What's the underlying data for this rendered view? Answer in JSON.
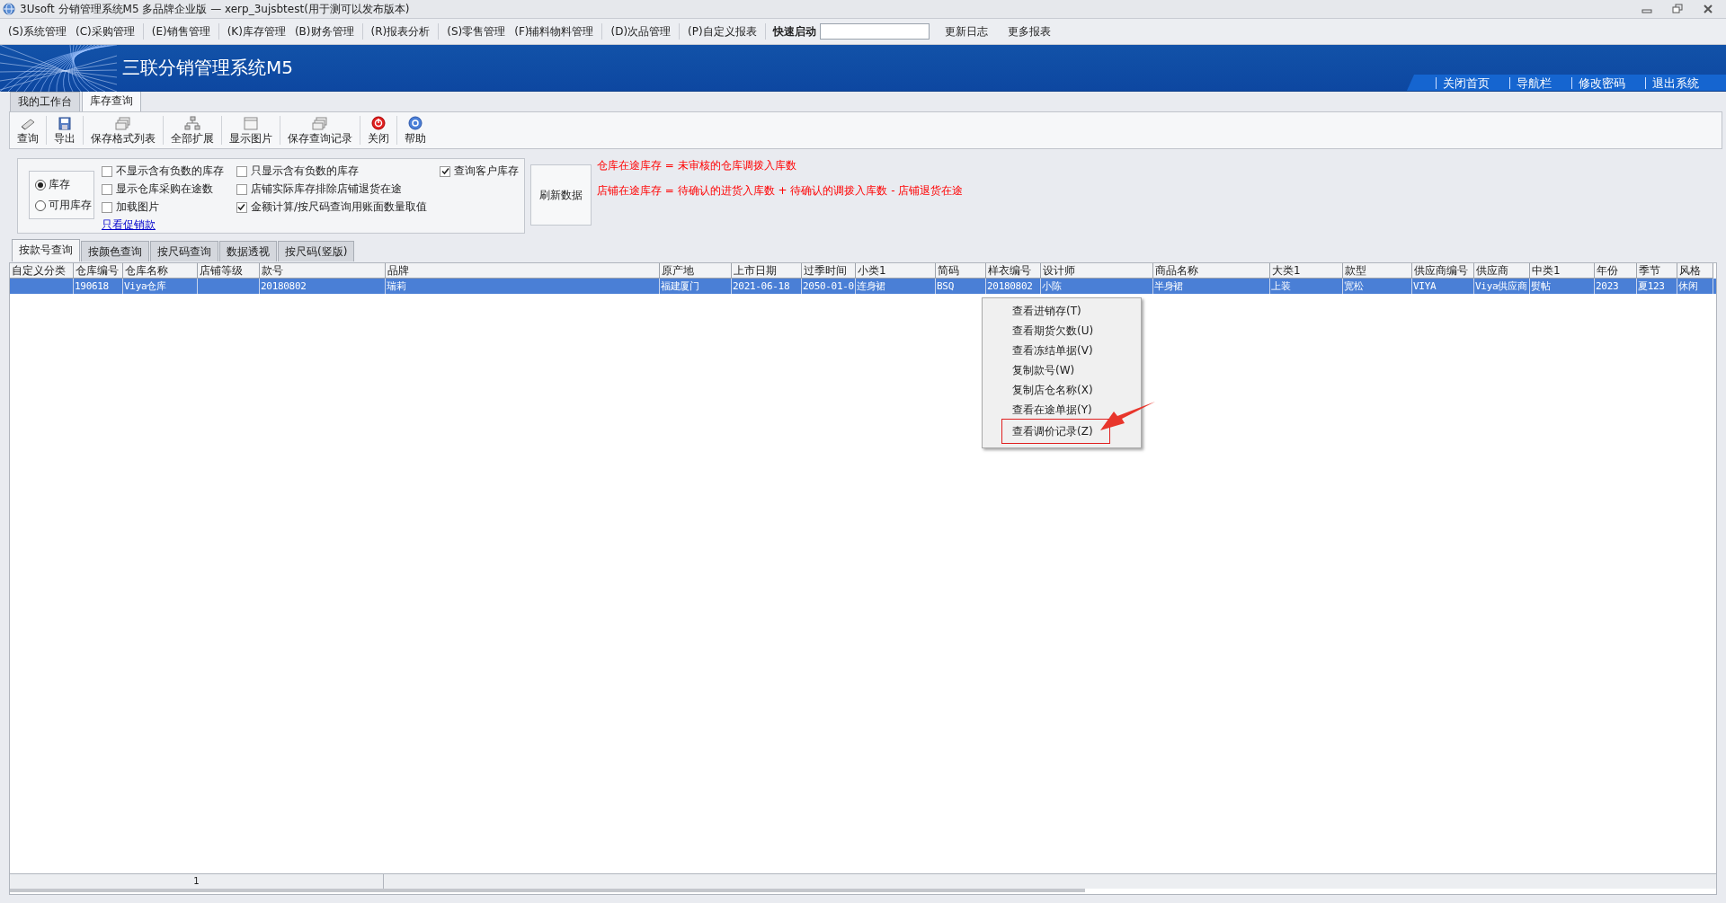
{
  "window": {
    "title": "3Usoft 分销管理系统M5 多品牌企业版 — xerp_3ujsbtest(用于测可以发布版本)"
  },
  "menu_bar": {
    "items": [
      {
        "label": "(S)系统管理",
        "group_end": false
      },
      {
        "label": "(C)采购管理",
        "group_end": true
      },
      {
        "label": "(E)销售管理",
        "group_end": true
      },
      {
        "label": "(K)库存管理",
        "group_end": false
      },
      {
        "label": "(B)财务管理",
        "group_end": true
      },
      {
        "label": "(R)报表分析",
        "group_end": true
      },
      {
        "label": "(S)零售管理",
        "group_end": false
      },
      {
        "label": "(F)辅料物料管理",
        "group_end": true
      },
      {
        "label": "(D)次品管理",
        "group_end": true
      },
      {
        "label": "(P)自定义报表",
        "group_end": true
      }
    ],
    "quick_launch_label": "快速启动",
    "links": [
      "更新日志",
      "更多报表"
    ]
  },
  "banner": {
    "title": "三联分销管理系统M5",
    "links": [
      "关闭首页",
      "导航栏",
      "修改密码",
      "退出系统"
    ]
  },
  "page_tabs": [
    {
      "label": "我的工作台",
      "selected": false
    },
    {
      "label": "库存查询",
      "selected": true
    }
  ],
  "toolbar": [
    "查询",
    "导出",
    "保存格式列表",
    "全部扩展",
    "显示图片",
    "保存查询记录",
    "关闭",
    "帮助"
  ],
  "options": {
    "radios": [
      {
        "label": "库存",
        "selected": true
      },
      {
        "label": "可用库存",
        "selected": false
      }
    ],
    "checkbox_columns": [
      [
        {
          "label": "不显示含有负数的库存",
          "checked": false
        },
        {
          "label": "显示仓库采购在途数",
          "checked": false
        },
        {
          "label": "加载图片",
          "checked": false
        }
      ],
      [
        {
          "label": "只显示含有负数的库存",
          "checked": false
        },
        {
          "label": "店铺实际库存排除店铺退货在途",
          "checked": false
        },
        {
          "label": "金额计算/按尺码查询用账面数量取值",
          "checked": true
        }
      ],
      [
        {
          "label": "查询客户库存",
          "checked": true
        }
      ]
    ],
    "link": "只看促销款",
    "refresh_button": "刷新数据",
    "notes": [
      "仓库在途库存 = 未审核的仓库调拨入库数",
      "店铺在途库存 = 待确认的进货入库数 + 待确认的调拨入库数 - 店铺退货在途"
    ]
  },
  "query_tabs": [
    {
      "label": "按款号查询",
      "selected": true
    },
    {
      "label": "按颜色查询",
      "selected": false
    },
    {
      "label": "按尺码查询",
      "selected": false
    },
    {
      "label": "数据透视",
      "selected": false
    },
    {
      "label": "按尺码(竖版)",
      "selected": false
    }
  ],
  "table": {
    "columns": [
      "自定义分类",
      "仓库编号",
      "仓库名称",
      "店铺等级",
      "款号",
      "品牌",
      "原产地",
      "上市日期",
      "过季时间",
      "小类1",
      "简码",
      "样衣编号",
      "设计师",
      "商品名称",
      "大类1",
      "款型",
      "供应商编号",
      "供应商",
      "中类1",
      "年份",
      "季节",
      "风格"
    ],
    "rows": [
      {
        "selected": true,
        "cells": [
          null,
          "190618",
          "Viya仓库",
          null,
          "20180802",
          "瑞莉",
          "福建厦门",
          "2021-06-18",
          "2050-01-0",
          "连身裙",
          "BSQ",
          "20180802",
          "小陈",
          "半身裙",
          "上装",
          "宽松",
          "VIYA",
          "Viya供应商",
          "熨帖",
          "2023",
          "夏123",
          "休闲"
        ]
      }
    ],
    "footer": "1"
  },
  "context_menu": [
    {
      "label": "查看进销存(T)",
      "annotated": false
    },
    {
      "label": "查看期货欠数(U)",
      "annotated": false
    },
    {
      "label": "查看冻结单据(V)",
      "annotated": false
    },
    {
      "label": "复制款号(W)",
      "annotated": false
    },
    {
      "label": "复制店仓名称(X)",
      "annotated": false
    },
    {
      "label": "查看在途单据(Y)",
      "annotated": false
    },
    {
      "label": "查看调价记录(Z)",
      "annotated": true
    }
  ]
}
